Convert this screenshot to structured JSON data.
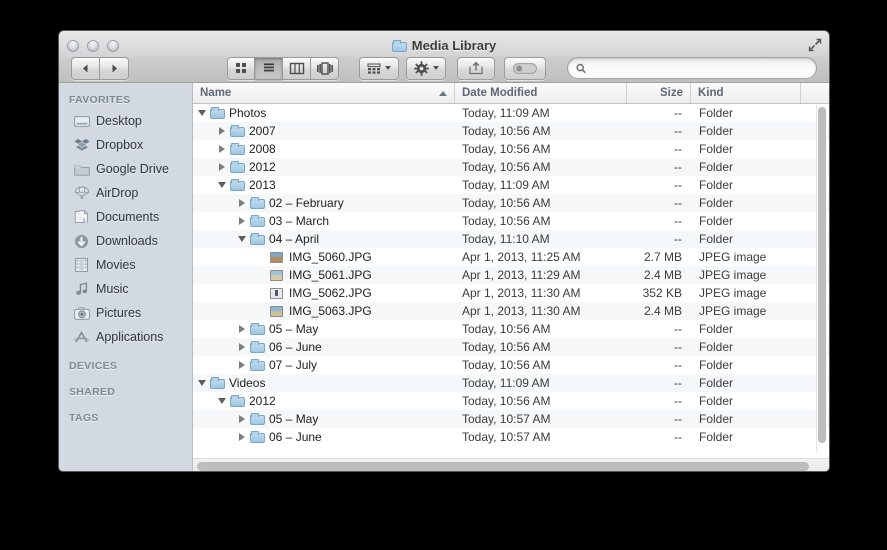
{
  "window": {
    "title": "Media Library",
    "title_icon": "folder-icon",
    "fullscreen_icon": "fullscreen-expand-icon",
    "traffic_lights": [
      "close-button",
      "minimize-button",
      "zoom-button"
    ]
  },
  "toolbar": {
    "back_label": "◀",
    "forward_label": "▶",
    "back_name": "back-button",
    "forward_name": "forward-button",
    "view_modes": [
      {
        "name": "icon-view-button",
        "icon": "grid-icon",
        "active": false
      },
      {
        "name": "list-view-button",
        "icon": "list-icon",
        "active": true
      },
      {
        "name": "column-view-button",
        "icon": "columns-icon",
        "active": false
      },
      {
        "name": "coverflow-view-button",
        "icon": "coverflow-icon",
        "active": false
      }
    ],
    "arrange_button": {
      "name": "arrange-by-button",
      "icon": "grid-small-icon"
    },
    "action_button": {
      "name": "action-gear-button",
      "icon": "gear-icon"
    },
    "share_button": {
      "name": "share-button",
      "icon": "share-arrow-icon"
    },
    "tags_button": {
      "name": "edit-tags-button",
      "icon": "tag-pill-icon"
    }
  },
  "search": {
    "value": "",
    "placeholder": "",
    "icon": "search-icon"
  },
  "sidebar": {
    "sections": [
      {
        "header": "FAVORITES",
        "items": [
          {
            "label": "Desktop",
            "icon": "desktop-icon"
          },
          {
            "label": "Dropbox",
            "icon": "dropbox-icon"
          },
          {
            "label": "Google Drive",
            "icon": "folder-icon"
          },
          {
            "label": "AirDrop",
            "icon": "airdrop-parachute-icon"
          },
          {
            "label": "Documents",
            "icon": "documents-icon"
          },
          {
            "label": "Downloads",
            "icon": "downloads-arrow-icon"
          },
          {
            "label": "Movies",
            "icon": "film-strip-icon"
          },
          {
            "label": "Music",
            "icon": "music-note-icon"
          },
          {
            "label": "Pictures",
            "icon": "camera-icon"
          },
          {
            "label": "Applications",
            "icon": "applications-icon"
          }
        ]
      },
      {
        "header": "DEVICES",
        "items": []
      },
      {
        "header": "SHARED",
        "items": []
      },
      {
        "header": "TAGS",
        "items": []
      }
    ]
  },
  "file_list": {
    "columns": [
      {
        "key": "name",
        "label": "Name",
        "sorted": true,
        "sort_direction": "asc"
      },
      {
        "key": "date",
        "label": "Date Modified",
        "sorted": false
      },
      {
        "key": "size",
        "label": "Size",
        "sorted": false
      },
      {
        "key": "kind",
        "label": "Kind",
        "sorted": false
      }
    ],
    "rows": [
      {
        "name": "Photos",
        "date": "Today, 11:09 AM",
        "size": "--",
        "kind": "Folder",
        "depth": 0,
        "state": "open",
        "icon": "folder-icon"
      },
      {
        "name": "2007",
        "date": "Today, 10:56 AM",
        "size": "--",
        "kind": "Folder",
        "depth": 1,
        "state": "closed",
        "icon": "folder-icon"
      },
      {
        "name": "2008",
        "date": "Today, 10:56 AM",
        "size": "--",
        "kind": "Folder",
        "depth": 1,
        "state": "closed",
        "icon": "folder-icon"
      },
      {
        "name": "2012",
        "date": "Today, 10:56 AM",
        "size": "--",
        "kind": "Folder",
        "depth": 1,
        "state": "closed",
        "icon": "folder-icon"
      },
      {
        "name": "2013",
        "date": "Today, 11:09 AM",
        "size": "--",
        "kind": "Folder",
        "depth": 1,
        "state": "open",
        "icon": "folder-icon"
      },
      {
        "name": "02 – February",
        "date": "Today, 10:56 AM",
        "size": "--",
        "kind": "Folder",
        "depth": 2,
        "state": "closed",
        "icon": "folder-icon"
      },
      {
        "name": "03 – March",
        "date": "Today, 10:56 AM",
        "size": "--",
        "kind": "Folder",
        "depth": 2,
        "state": "closed",
        "icon": "folder-icon"
      },
      {
        "name": "04 – April",
        "date": "Today, 11:10 AM",
        "size": "--",
        "kind": "Folder",
        "depth": 2,
        "state": "open",
        "icon": "folder-icon"
      },
      {
        "name": "IMG_5060.JPG",
        "date": "Apr 1, 2013, 11:25 AM",
        "size": "2.7 MB",
        "kind": "JPEG image",
        "depth": 3,
        "state": "leaf",
        "icon": "jpeg-thumbnail-1"
      },
      {
        "name": "IMG_5061.JPG",
        "date": "Apr 1, 2013, 11:29 AM",
        "size": "2.4 MB",
        "kind": "JPEG image",
        "depth": 3,
        "state": "leaf",
        "icon": "jpeg-thumbnail-2"
      },
      {
        "name": "IMG_5062.JPG",
        "date": "Apr 1, 2013, 11:30 AM",
        "size": "352 KB",
        "kind": "JPEG image",
        "depth": 3,
        "state": "leaf",
        "icon": "jpeg-thumbnail-3"
      },
      {
        "name": "IMG_5063.JPG",
        "date": "Apr 1, 2013, 11:30 AM",
        "size": "2.4 MB",
        "kind": "JPEG image",
        "depth": 3,
        "state": "leaf",
        "icon": "jpeg-thumbnail-4"
      },
      {
        "name": "05 – May",
        "date": "Today, 10:56 AM",
        "size": "--",
        "kind": "Folder",
        "depth": 2,
        "state": "closed",
        "icon": "folder-icon"
      },
      {
        "name": "06 – June",
        "date": "Today, 10:56 AM",
        "size": "--",
        "kind": "Folder",
        "depth": 2,
        "state": "closed",
        "icon": "folder-icon"
      },
      {
        "name": "07 – July",
        "date": "Today, 10:56 AM",
        "size": "--",
        "kind": "Folder",
        "depth": 2,
        "state": "closed",
        "icon": "folder-icon"
      },
      {
        "name": "Videos",
        "date": "Today, 11:09 AM",
        "size": "--",
        "kind": "Folder",
        "depth": 0,
        "state": "open",
        "icon": "folder-icon"
      },
      {
        "name": "2012",
        "date": "Today, 10:56 AM",
        "size": "--",
        "kind": "Folder",
        "depth": 1,
        "state": "open",
        "icon": "folder-icon"
      },
      {
        "name": "05 – May",
        "date": "Today, 10:57 AM",
        "size": "--",
        "kind": "Folder",
        "depth": 2,
        "state": "closed",
        "icon": "folder-icon"
      },
      {
        "name": "06 – June",
        "date": "Today, 10:57 AM",
        "size": "--",
        "kind": "Folder",
        "depth": 2,
        "state": "closed",
        "icon": "folder-icon"
      }
    ]
  },
  "scrollbars": {
    "vertical": {
      "name": "vertical-scrollbar"
    },
    "horizontal": {
      "name": "horizontal-scrollbar"
    }
  },
  "colors": {
    "sidebar_bg": "#d3d9e0",
    "row_alt_bg": "#f5f7f9",
    "header_text": "#5c6876",
    "folder_blue": "#9ec6e2"
  }
}
